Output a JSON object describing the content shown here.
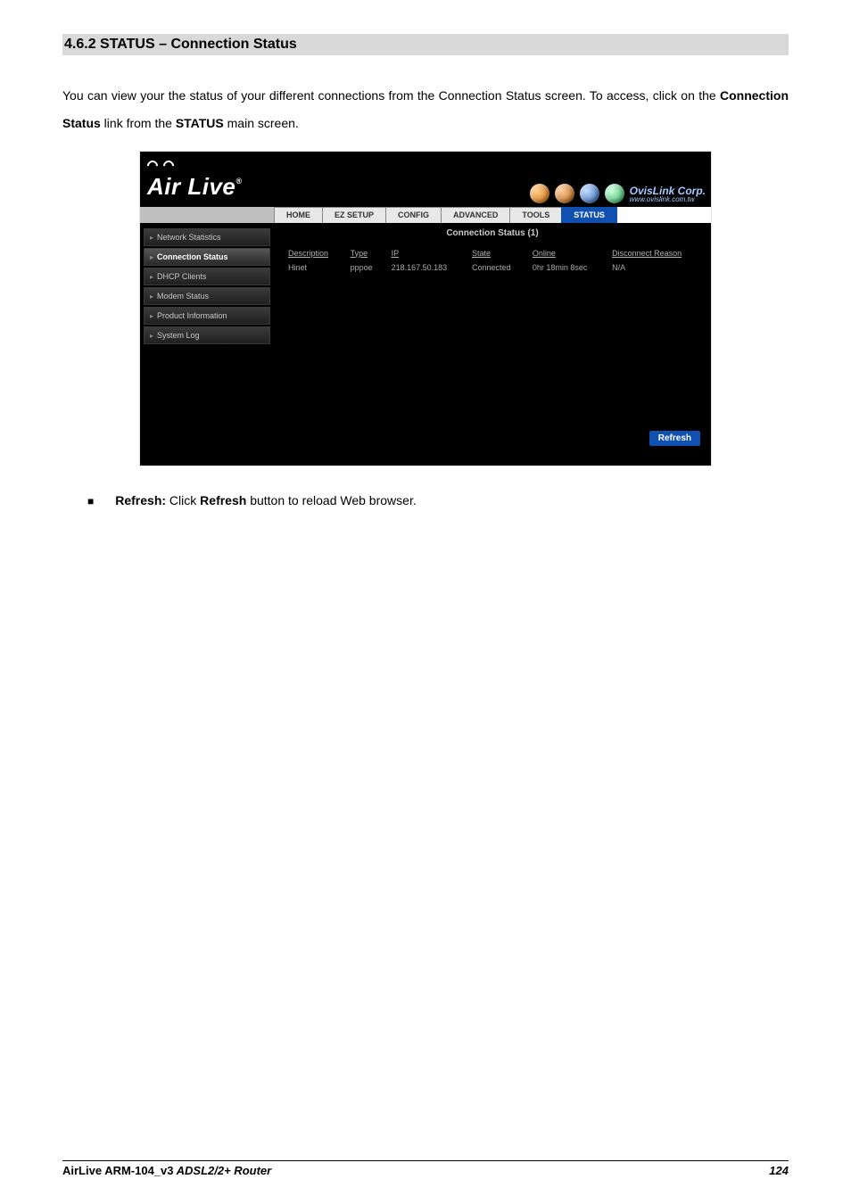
{
  "heading": "4.6.2 STATUS – Connection Status",
  "intro_1": "You can view your the status of your different connections from the Connection Status screen. To access, click on the ",
  "intro_b1": "Connection Status",
  "intro_2": " link from the ",
  "intro_b2": "STATUS",
  "intro_3": " main screen.",
  "logo_text": "Air Live",
  "ovis_corp": "OvisLink Corp.",
  "ovis_url": "www.ovislink.com.tw",
  "tabs": {
    "home": "HOME",
    "ezsetup": "EZ SETUP",
    "config": "CONFIG",
    "advanced": "ADVANCED",
    "tools": "TOOLS",
    "status": "STATUS"
  },
  "sidebar": {
    "netstats": "Network Statistics",
    "connstatus": "Connection Status",
    "dhcp": "DHCP Clients",
    "modem": "Modem Status",
    "prodinfo": "Product Information",
    "syslog": "System Log"
  },
  "content_title": "Connection Status (1)",
  "table": {
    "headers": {
      "description": "Description",
      "type": "Type",
      "ip": "IP",
      "state": "State",
      "online": "Online",
      "disconnect": "Disconnect Reason"
    },
    "row": {
      "description": "Hinet",
      "type": "pppoe",
      "ip": "218.167.50.183",
      "state": "Connected",
      "online": "0hr 18min 8sec",
      "disconnect": "N/A"
    }
  },
  "refresh_label": "Refresh",
  "bullet": {
    "b1": "Refresh:",
    "t1": " Click ",
    "b2": "Refresh",
    "t2": " button to reload Web browser."
  },
  "footer": {
    "product": "AirLive ARM-104_v3",
    "model_suffix": " ADSL2/2+ Router",
    "page": "124"
  }
}
